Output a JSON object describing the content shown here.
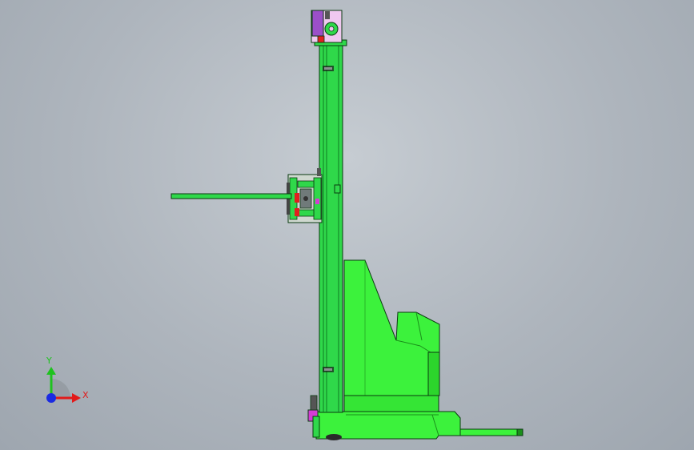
{
  "viewport": {
    "background_top": "#c6ccd2",
    "background_bottom": "#9ea6af"
  },
  "model": {
    "colors": {
      "frame_green": "#2fd84a",
      "frame_green_dark": "#0f7a22",
      "body_green": "#3cf23c",
      "body_green_dark": "#1a8f1a",
      "magenta": "#d43cd4",
      "purple": "#9b4fc8",
      "pink_light": "#f0c8f0",
      "red": "#e02020",
      "dark_outline": "#0a3a10",
      "grey": "#8a9090"
    }
  },
  "triad": {
    "x_label": "X",
    "y_label": "Y",
    "x_color": "#e21a1a",
    "y_color": "#1ec21e",
    "z_color": "#1a2ae2"
  }
}
